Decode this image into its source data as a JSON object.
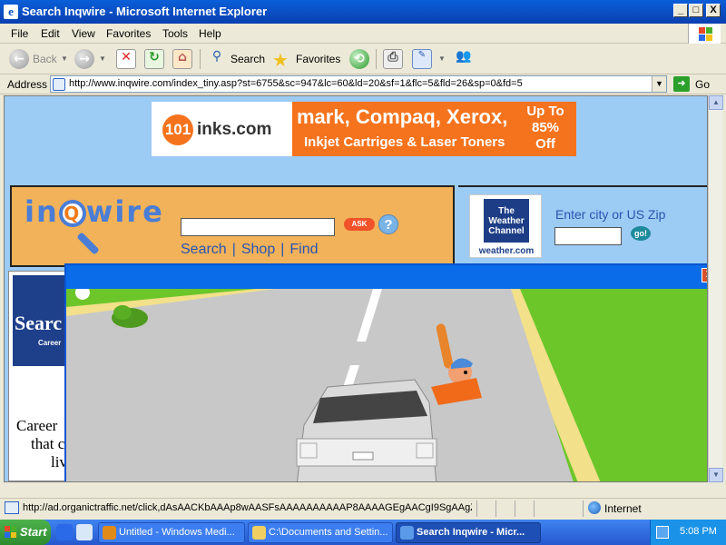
{
  "window": {
    "title": "Search Inqwire - Microsoft Internet Explorer",
    "minimize": "_",
    "maximize": "□",
    "close": "X"
  },
  "menu": [
    "File",
    "Edit",
    "View",
    "Favorites",
    "Tools",
    "Help"
  ],
  "toolbar": {
    "back": "Back",
    "search": "Search",
    "favorites": "Favorites"
  },
  "address": {
    "label": "Address",
    "url": "http://www.inqwire.com/index_tiny.asp?st=6755&sc=947&lc=60&ld=20&sf=1&flc=5&fld=26&sp=0&fd=5",
    "go": "Go"
  },
  "ad_banner": {
    "logo_number": "101",
    "domain": "inks.com",
    "brands": "mark, Compaq, Xerox,",
    "subtitle": "Inkjet Cartriges & Laser Toners",
    "offer": [
      "Up To",
      "85%",
      "Off"
    ]
  },
  "inqwire": {
    "logo_pre": "in",
    "logo_q": "Q",
    "logo_post": "wire",
    "ask": "ASK",
    "links": [
      "Search",
      "Shop",
      "Find"
    ]
  },
  "weather": {
    "logo_lines": [
      "The",
      "Weather",
      "Channel"
    ],
    "logo_domain": "weather.com",
    "label": "Enter city or US Zip",
    "go": "go!"
  },
  "career": {
    "title": "Searc",
    "subtitle": "Career",
    "text": [
      "Career",
      "that cl",
      "liv"
    ]
  },
  "status": {
    "text": "http://ad.organictraffic.net/click,dAsAACKbAAAp8wAASFsAAAAAAAAAAP8AAAAGEgAACgI9SgAAgZA/",
    "zone": "Internet"
  },
  "taskbar": {
    "start": "Start",
    "tasks": [
      "Untitled - Windows Medi...",
      "C:\\Documents and Settin...",
      "Search Inqwire - Micr..."
    ],
    "clock": "5:08 PM"
  },
  "colors": {
    "titlebar": "#0a4fc4",
    "page_background": "#9ccbf4",
    "ad_orange": "#f6731d",
    "inqwire_panel": "#f2b25a",
    "road": "#c8c8c8",
    "grass": "#6cc62a"
  }
}
